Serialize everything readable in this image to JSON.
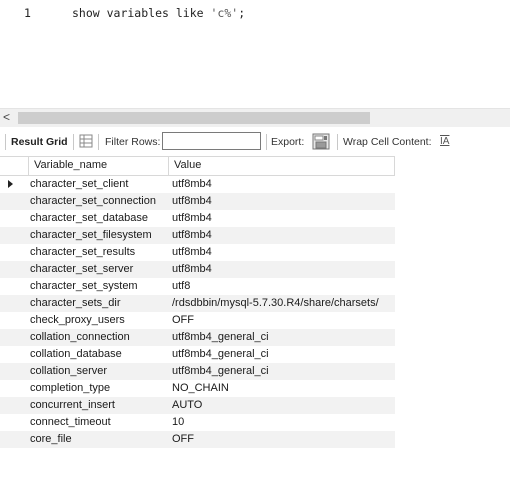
{
  "editor": {
    "line_number": "1",
    "code_keyword": "show variables like ",
    "code_string": "'c%'",
    "code_end": ";"
  },
  "scrollbar": {
    "left_arrow": "<"
  },
  "toolbar": {
    "result_grid_label": "Result Grid",
    "filter_rows_label": "Filter Rows:",
    "filter_value": "",
    "export_label": "Export:",
    "wrap_label": "Wrap Cell Content:",
    "wrap_icon_glyph": "IA"
  },
  "grid": {
    "columns": [
      "Variable_name",
      "Value"
    ],
    "rows": [
      [
        "character_set_client",
        "utf8mb4"
      ],
      [
        "character_set_connection",
        "utf8mb4"
      ],
      [
        "character_set_database",
        "utf8mb4"
      ],
      [
        "character_set_filesystem",
        "utf8mb4"
      ],
      [
        "character_set_results",
        "utf8mb4"
      ],
      [
        "character_set_server",
        "utf8mb4"
      ],
      [
        "character_set_system",
        "utf8"
      ],
      [
        "character_sets_dir",
        "/rdsdbbin/mysql-5.7.30.R4/share/charsets/"
      ],
      [
        "check_proxy_users",
        "OFF"
      ],
      [
        "collation_connection",
        "utf8mb4_general_ci"
      ],
      [
        "collation_database",
        "utf8mb4_general_ci"
      ],
      [
        "collation_server",
        "utf8mb4_general_ci"
      ],
      [
        "completion_type",
        "NO_CHAIN"
      ],
      [
        "concurrent_insert",
        "AUTO"
      ],
      [
        "connect_timeout",
        "10"
      ],
      [
        "core_file",
        "OFF"
      ]
    ]
  }
}
